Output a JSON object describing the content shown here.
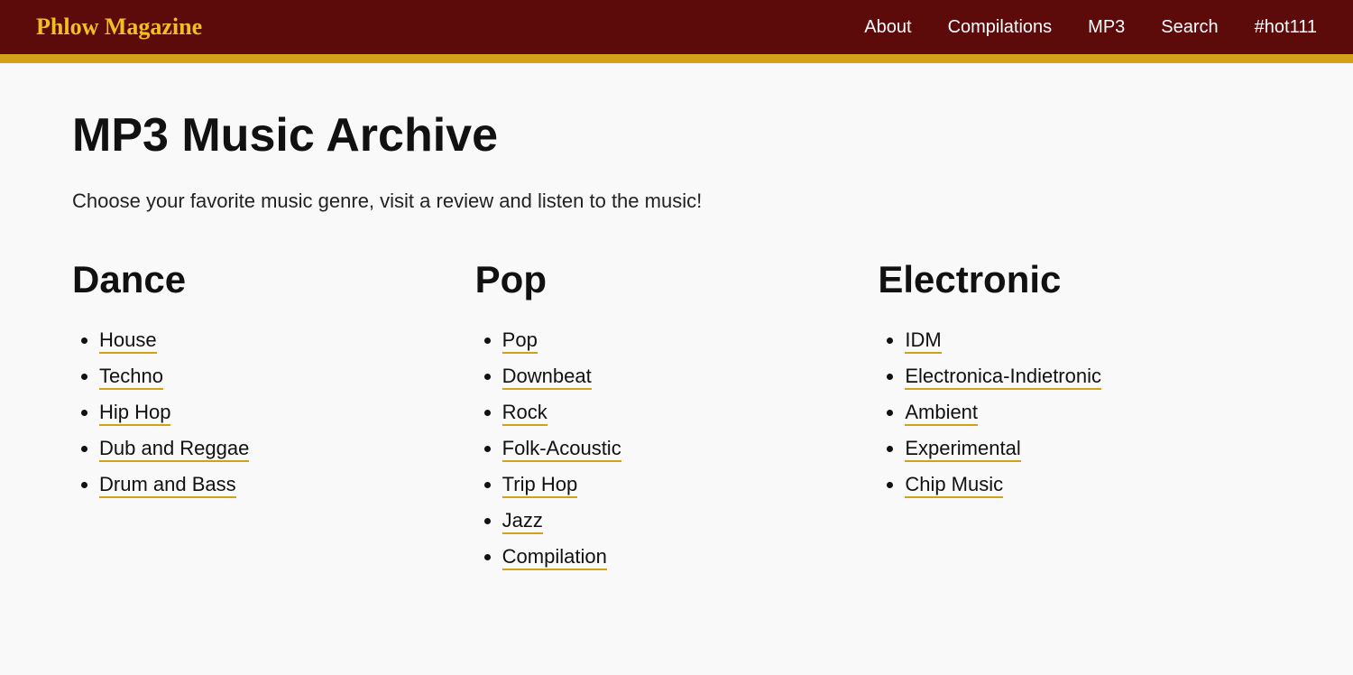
{
  "header": {
    "site_title": "Phlow Magazine",
    "nav_items": [
      {
        "label": "About",
        "href": "#"
      },
      {
        "label": "Compilations",
        "href": "#"
      },
      {
        "label": "MP3",
        "href": "#"
      },
      {
        "label": "Search",
        "href": "#"
      },
      {
        "label": "#hot111",
        "href": "#"
      }
    ]
  },
  "main": {
    "page_title": "MP3 Music Archive",
    "subtitle": "Choose your favorite music genre, visit a review and listen to the music!",
    "genres": [
      {
        "category": "Dance",
        "items": [
          {
            "label": "House"
          },
          {
            "label": "Techno"
          },
          {
            "label": "Hip Hop"
          },
          {
            "label": "Dub and Reggae"
          },
          {
            "label": "Drum and Bass"
          }
        ]
      },
      {
        "category": "Pop",
        "items": [
          {
            "label": "Pop"
          },
          {
            "label": "Downbeat"
          },
          {
            "label": "Rock"
          },
          {
            "label": "Folk-Acoustic"
          },
          {
            "label": "Trip Hop"
          },
          {
            "label": "Jazz"
          },
          {
            "label": "Compilation"
          }
        ]
      },
      {
        "category": "Electronic",
        "items": [
          {
            "label": "IDM"
          },
          {
            "label": "Electronica-Indietronic"
          },
          {
            "label": "Ambient"
          },
          {
            "label": "Experimental"
          },
          {
            "label": "Chip Music"
          }
        ]
      }
    ]
  },
  "colors": {
    "header_bg": "#5c0a0a",
    "gold_stripe": "#d4a017",
    "site_title_color": "#f0c020",
    "link_underline": "#d4a017"
  }
}
